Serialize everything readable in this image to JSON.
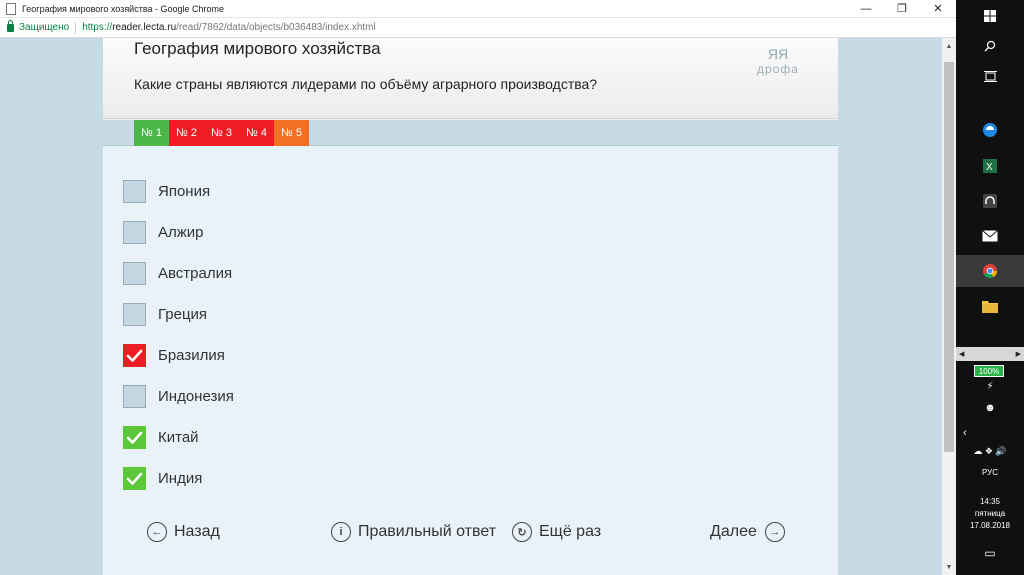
{
  "window": {
    "title": "География мирового хозяйства - Google Chrome",
    "minimize_icon": "minimize-icon",
    "maximize_icon": "restore-icon",
    "close_icon": "close-icon"
  },
  "address": {
    "secure_label": "Защищено",
    "url_scheme": "https://",
    "url_host": "reader.lecta.ru",
    "url_path": "/read/7862/data/objects/b036483/index.xhtml"
  },
  "page": {
    "title": "География мирового хозяйства",
    "question": "Какие страны являются лидерами по объёму аграрного производства?",
    "logo_text": "дрофа",
    "logo_mark": "ЯЯ"
  },
  "tabs": [
    {
      "label": "№ 1",
      "color": "#4cb648"
    },
    {
      "label": "№ 2",
      "color": "#ee1d24"
    },
    {
      "label": "№ 3",
      "color": "#ee1d24"
    },
    {
      "label": "№ 4",
      "color": "#ee1d24"
    },
    {
      "label": "№ 5",
      "color": "#f36f21"
    }
  ],
  "options": [
    {
      "label": "Япония",
      "state": "empty"
    },
    {
      "label": "Алжир",
      "state": "empty"
    },
    {
      "label": "Австралия",
      "state": "empty"
    },
    {
      "label": "Греция",
      "state": "empty"
    },
    {
      "label": "Бразилия",
      "state": "wrong"
    },
    {
      "label": "Индонезия",
      "state": "empty"
    },
    {
      "label": "Китай",
      "state": "correct"
    },
    {
      "label": "Индия",
      "state": "correct"
    }
  ],
  "footer": {
    "back": "Назад",
    "answer": "Правильный ответ",
    "retry": "Ещё раз",
    "next": "Далее"
  },
  "taskbar": {
    "battery": "100%",
    "lang": "РУС",
    "time": "14:35",
    "day": "пятница",
    "date": "17.08.2018"
  }
}
